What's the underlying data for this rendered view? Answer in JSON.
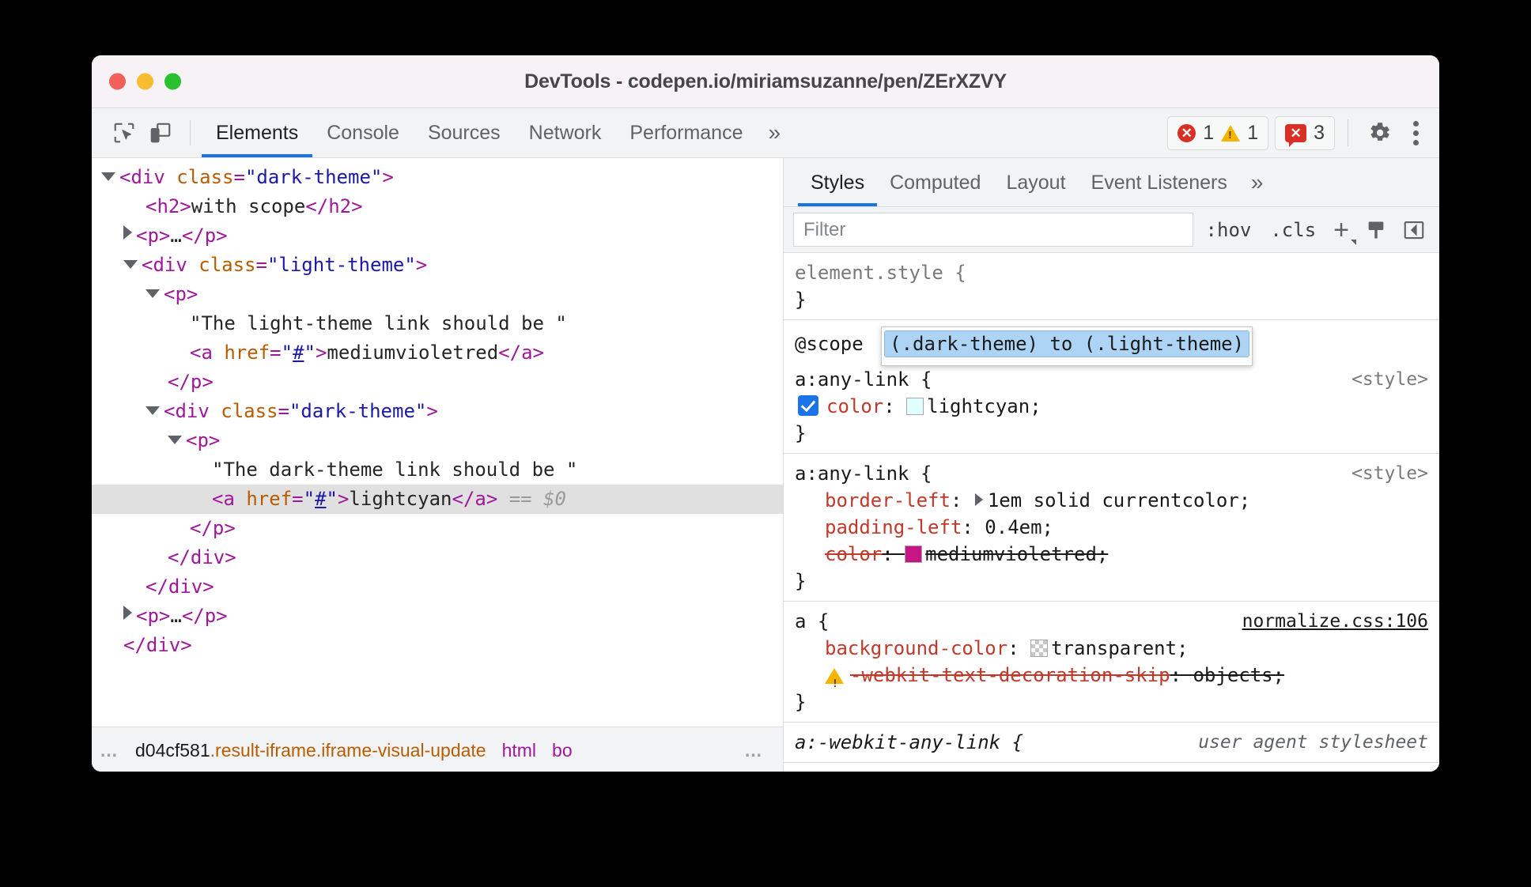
{
  "window": {
    "title": "DevTools - codepen.io/miriamsuzanne/pen/ZErXZVY",
    "traffic_lights": [
      "close",
      "minimize",
      "zoom"
    ]
  },
  "toolbar": {
    "inspect_icon": "inspect-element-icon",
    "device_icon": "device-toolbar-icon",
    "tabs": [
      {
        "label": "Elements",
        "active": true
      },
      {
        "label": "Console",
        "active": false
      },
      {
        "label": "Sources",
        "active": false
      },
      {
        "label": "Network",
        "active": false
      },
      {
        "label": "Performance",
        "active": false
      }
    ],
    "more_tabs": "»",
    "errors_count": "1",
    "warnings_count": "1",
    "issues_count": "3",
    "settings_icon": "gear-icon",
    "menu_icon": "kebab-menu-icon",
    "colors": {
      "error": "#d93025",
      "warning": "#f5b400",
      "accent": "#1a73e8"
    }
  },
  "dom_tree": {
    "rows": [
      {
        "indent": 0,
        "twisty": "open",
        "segments": [
          {
            "t": "tag",
            "v": "<div "
          },
          {
            "t": "attrn",
            "v": "class"
          },
          {
            "t": "tag",
            "v": "="
          },
          {
            "t": "attrv",
            "v": "\"dark-theme\""
          },
          {
            "t": "tag",
            "v": ">"
          }
        ]
      },
      {
        "indent": 1,
        "twisty": "blank",
        "segments": [
          {
            "t": "tag",
            "v": "<h2>"
          },
          {
            "t": "txt",
            "v": "with scope"
          },
          {
            "t": "tag",
            "v": "</h2>"
          }
        ]
      },
      {
        "indent": 1,
        "twisty": "closed",
        "segments": [
          {
            "t": "tag",
            "v": "<p>"
          },
          {
            "t": "txt",
            "v": "…"
          },
          {
            "t": "tag",
            "v": "</p>"
          }
        ]
      },
      {
        "indent": 1,
        "twisty": "open",
        "segments": [
          {
            "t": "tag",
            "v": "<div "
          },
          {
            "t": "attrn",
            "v": "class"
          },
          {
            "t": "tag",
            "v": "="
          },
          {
            "t": "attrv",
            "v": "\"light-theme\""
          },
          {
            "t": "tag",
            "v": ">"
          }
        ]
      },
      {
        "indent": 2,
        "twisty": "open",
        "segments": [
          {
            "t": "tag",
            "v": "<p>"
          }
        ]
      },
      {
        "indent": 3,
        "twisty": "blank",
        "segments": [
          {
            "t": "txt",
            "v": "\"The light-theme link should be \""
          }
        ]
      },
      {
        "indent": 3,
        "twisty": "blank",
        "segments": [
          {
            "t": "tag",
            "v": "<a "
          },
          {
            "t": "attrn",
            "v": "href"
          },
          {
            "t": "tag",
            "v": "="
          },
          {
            "t": "attrv",
            "v": "\""
          },
          {
            "t": "href",
            "v": "#"
          },
          {
            "t": "attrv",
            "v": "\""
          },
          {
            "t": "tag",
            "v": ">"
          },
          {
            "t": "txt",
            "v": "mediumvioletred"
          },
          {
            "t": "tag",
            "v": "</a>"
          }
        ]
      },
      {
        "indent": 2,
        "twisty": "blank",
        "segments": [
          {
            "t": "tag",
            "v": "</p>"
          }
        ]
      },
      {
        "indent": 2,
        "twisty": "open",
        "segments": [
          {
            "t": "tag",
            "v": "<div "
          },
          {
            "t": "attrn",
            "v": "class"
          },
          {
            "t": "tag",
            "v": "="
          },
          {
            "t": "attrv",
            "v": "\"dark-theme\""
          },
          {
            "t": "tag",
            "v": ">"
          }
        ]
      },
      {
        "indent": 3,
        "twisty": "open",
        "segments": [
          {
            "t": "tag",
            "v": "<p>"
          }
        ]
      },
      {
        "indent": 4,
        "twisty": "blank",
        "segments": [
          {
            "t": "txt",
            "v": "\"The dark-theme link should be \""
          }
        ]
      },
      {
        "indent": 4,
        "twisty": "blank",
        "selected": true,
        "segments": [
          {
            "t": "tag",
            "v": "<a "
          },
          {
            "t": "attrn",
            "v": "href"
          },
          {
            "t": "tag",
            "v": "="
          },
          {
            "t": "attrv",
            "v": "\""
          },
          {
            "t": "href",
            "v": "#"
          },
          {
            "t": "attrv",
            "v": "\""
          },
          {
            "t": "tag",
            "v": ">"
          },
          {
            "t": "txt",
            "v": "lightcyan"
          },
          {
            "t": "tag",
            "v": "</a>"
          },
          {
            "t": "eq",
            "v": " == "
          },
          {
            "t": "dollar",
            "v": "$0"
          }
        ]
      },
      {
        "indent": 3,
        "twisty": "blank",
        "segments": [
          {
            "t": "tag",
            "v": "</p>"
          }
        ]
      },
      {
        "indent": 2,
        "twisty": "blank",
        "segments": [
          {
            "t": "tag",
            "v": "</div>"
          }
        ]
      },
      {
        "indent": 1,
        "twisty": "blank",
        "segments": [
          {
            "t": "tag",
            "v": "</div>"
          }
        ]
      },
      {
        "indent": 1,
        "twisty": "closed",
        "segments": [
          {
            "t": "tag",
            "v": "<p>"
          },
          {
            "t": "txt",
            "v": "…"
          },
          {
            "t": "tag",
            "v": "</p>"
          }
        ]
      },
      {
        "indent": 0,
        "twisty": "blank",
        "segments": [
          {
            "t": "tag",
            "v": "</div>"
          }
        ]
      }
    ]
  },
  "breadcrumb": {
    "leading_ellipsis": "…",
    "items": [
      {
        "node": "d04cf581",
        "classes": ".result-iframe.iframe-visual-update"
      },
      {
        "node": "html",
        "classes": ""
      },
      {
        "node": "bo",
        "classes": ""
      }
    ],
    "trailing_ellipsis": "…"
  },
  "styles": {
    "tabs": [
      {
        "label": "Styles",
        "active": true
      },
      {
        "label": "Computed",
        "active": false
      },
      {
        "label": "Layout",
        "active": false
      },
      {
        "label": "Event Listeners",
        "active": false
      }
    ],
    "more_tabs": "»",
    "filter_placeholder": "Filter",
    "filter_value": "",
    "hov_label": ":hov",
    "cls_label": ".cls",
    "new_rule_icon": "plus-icon",
    "computed_icon": "style-pane-icon",
    "sidebar_toggle_icon": "sidebar-toggle-icon",
    "rules": [
      {
        "selector": "element.style {",
        "close": "}",
        "source": "",
        "greyed": true,
        "declarations": []
      },
      {
        "at_scope_keyword": "@scope",
        "at_scope_prelude": "(.dark-theme) to (.light-theme)",
        "selector": "a:any-link {",
        "close": "}",
        "source": "<style>",
        "declarations": [
          {
            "checkbox": true,
            "property": "color",
            "value": "lightcyan",
            "swatch": "#e0ffff",
            "strike": false
          }
        ]
      },
      {
        "selector": "a:any-link {",
        "close": "}",
        "source": "<style>",
        "declarations": [
          {
            "property": "border-left",
            "value": "1em solid currentcolor",
            "expandable": true,
            "strike": false
          },
          {
            "property": "padding-left",
            "value": "0.4em",
            "strike": false
          },
          {
            "property": "color",
            "value": "mediumvioletred",
            "swatch": "#c71585",
            "strike": true
          }
        ]
      },
      {
        "selector": "a {",
        "close": "}",
        "source": "normalize.css:106",
        "source_is_link": true,
        "declarations": [
          {
            "property": "background-color",
            "value": "transparent",
            "swatch": "transparent",
            "strike": false
          },
          {
            "property": "-webkit-text-decoration-skip",
            "value": "objects",
            "strike": true,
            "warning": true
          }
        ]
      },
      {
        "selector": "a:-webkit-any-link {",
        "close": "",
        "source": "user agent stylesheet",
        "source_is_ua": true,
        "italic": true,
        "declarations": []
      }
    ]
  }
}
